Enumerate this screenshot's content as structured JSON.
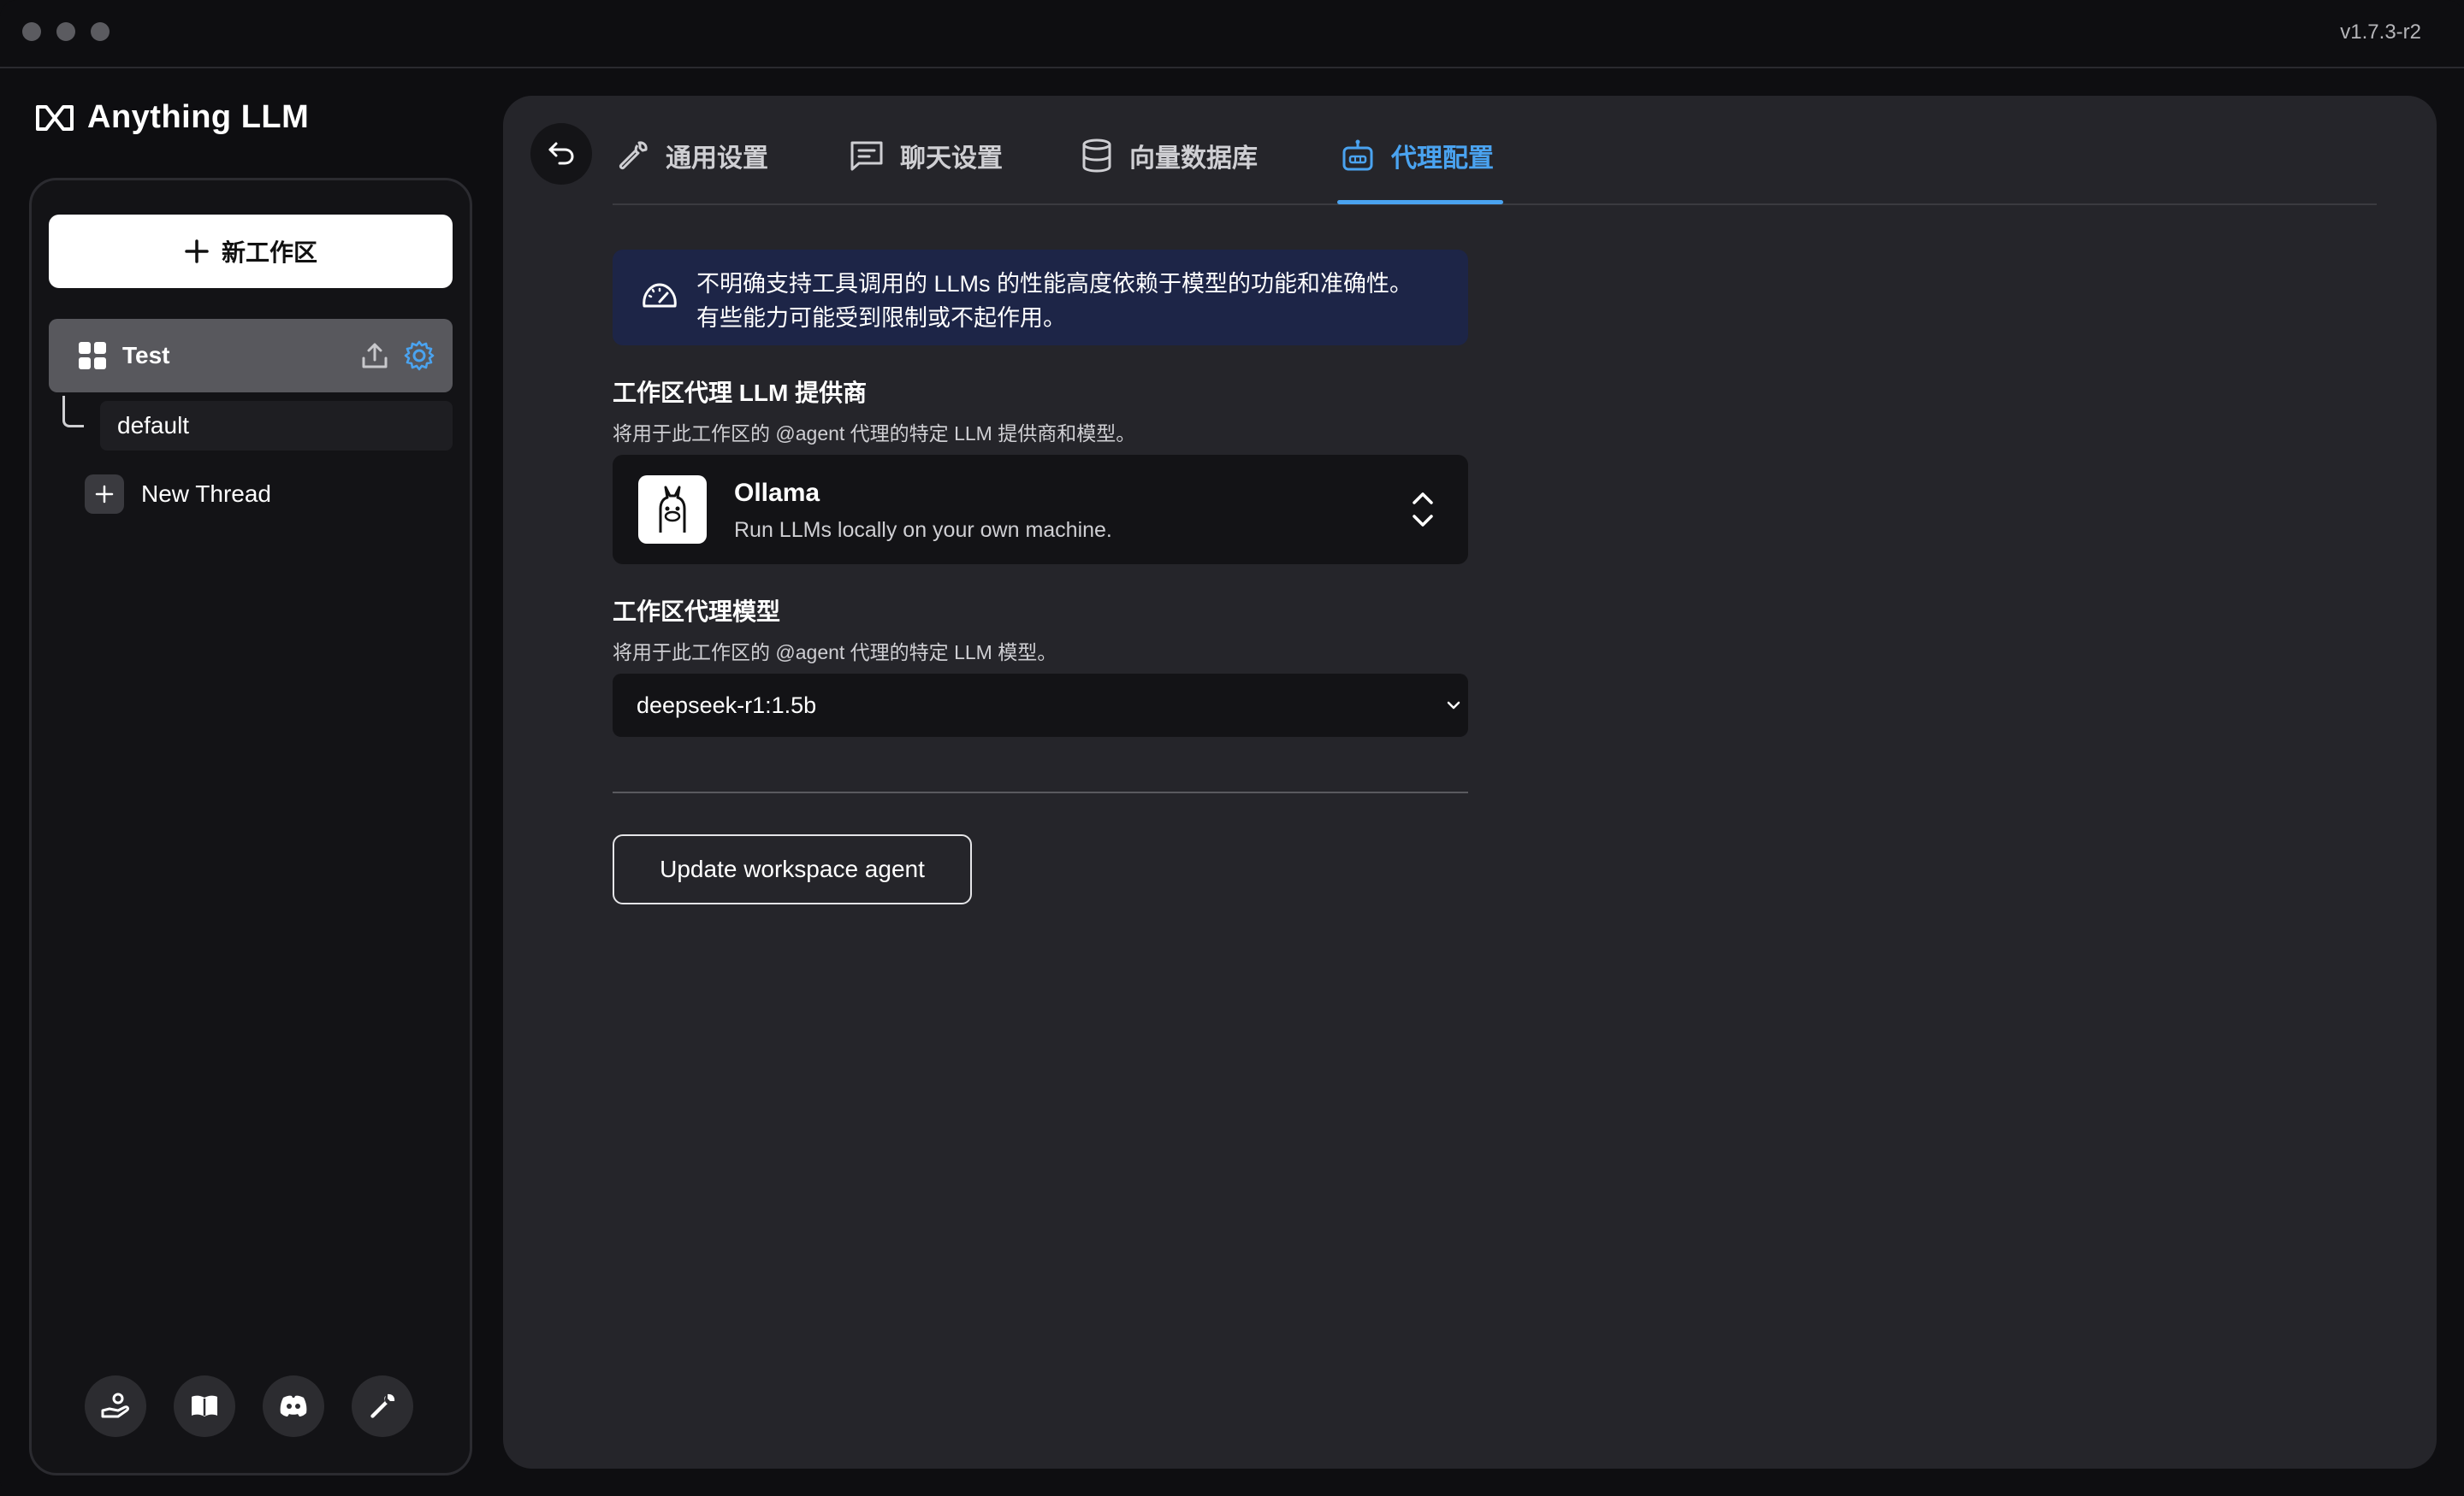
{
  "window": {
    "version": "v1.7.3-r2"
  },
  "brand": {
    "name": "Anything LLM"
  },
  "sidebar": {
    "new_workspace_label": "新工作区",
    "workspace": {
      "name": "Test"
    },
    "thread_default": "default",
    "new_thread_label": "New Thread",
    "footer_icons": [
      "community-hub-icon",
      "docs-book-icon",
      "discord-icon",
      "wrench-settings-icon"
    ]
  },
  "tabs": [
    {
      "label": "通用设置",
      "icon": "wrench-icon",
      "active": false
    },
    {
      "label": "聊天设置",
      "icon": "chat-icon",
      "active": false
    },
    {
      "label": "向量数据库",
      "icon": "database-icon",
      "active": false
    },
    {
      "label": "代理配置",
      "icon": "robot-icon",
      "active": true
    }
  ],
  "notice": {
    "line1": "不明确支持工具调用的 LLMs 的性能高度依赖于模型的功能和准确性。",
    "line2": "有些能力可能受到限制或不起作用。"
  },
  "provider_section": {
    "title": "工作区代理 LLM 提供商",
    "subtitle": "将用于此工作区的 @agent 代理的特定 LLM 提供商和模型。",
    "selected_name": "Ollama",
    "selected_desc": "Run LLMs locally on your own machine."
  },
  "model_section": {
    "title": "工作区代理模型",
    "subtitle": "将用于此工作区的 @agent 代理的特定 LLM 模型。",
    "selected_model": "deepseek-r1:1.5b"
  },
  "update_button_label": "Update workspace agent",
  "colors": {
    "accent": "#4aa3f0",
    "notice_bg": "#1d2547",
    "panel_bg": "#25252a"
  }
}
